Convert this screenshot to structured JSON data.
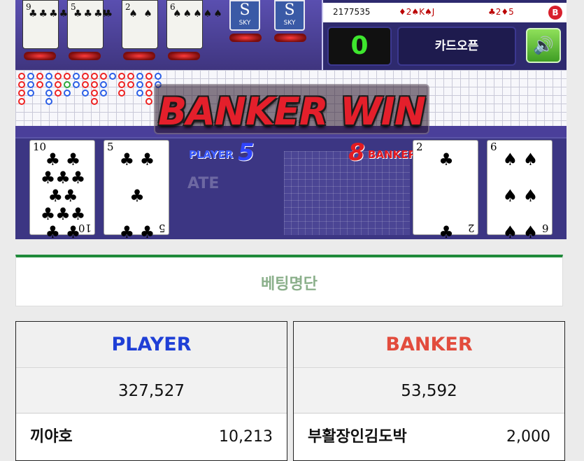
{
  "top_cards": [
    {
      "rank": "9",
      "pips": "♣♣♣♣♣♣♣♣"
    },
    {
      "rank": "5",
      "pips": "♣♣♣♣"
    },
    {
      "rank": "2",
      "pips": "♠  ♠"
    },
    {
      "rank": "6",
      "pips": "♠♠♠♠♠"
    }
  ],
  "card_backs": [
    {
      "logo": "S",
      "label": "SKY"
    },
    {
      "logo": "S",
      "label": "SKY"
    }
  ],
  "panel": {
    "round_id": "2177535",
    "player_hand": "♦2♠K♠J",
    "banker_hand": "♣2♦5",
    "badge": "B",
    "counter": "0",
    "open_button": "카드오픈",
    "sound_icon": "speaker-icon"
  },
  "result_banner": "BANKER WIN",
  "table": {
    "player_label": "PLAYER",
    "player_score": "5",
    "banker_score": "8",
    "banker_label": "BANKER",
    "faded_text": "ATE",
    "player_cards": [
      {
        "rank": "10",
        "suit": "♣",
        "pips": "♣ ♣\n♣♣♣\n♣♣\n♣♣♣\n♣ ♣"
      },
      {
        "rank": "5",
        "suit": "♣",
        "pips": "♣ ♣\n\n♣\n\n♣ ♣"
      }
    ],
    "banker_cards": [
      {
        "rank": "2",
        "suit": "♣",
        "pips": "♣\n\n\n\n♣"
      },
      {
        "rank": "6",
        "suit": "♠",
        "pips": "♠ ♠\n\n♠ ♠\n\n♠ ♠"
      }
    ]
  },
  "betting_list_title": "베팅명단",
  "columns": [
    {
      "title": "PLAYER",
      "color": "#1f3fd6",
      "total": "327,527",
      "entries": [
        {
          "name": "끼야호",
          "amount": "10,213"
        }
      ]
    },
    {
      "title": "BANKER",
      "color": "#e24c3d",
      "total": "53,592",
      "entries": [
        {
          "name": "부활장인김도박",
          "amount": "2,000"
        }
      ]
    }
  ],
  "colors": {
    "player": "#1f3fd6",
    "banker": "#e24c3d",
    "accent_green": "#1f8a3a"
  }
}
